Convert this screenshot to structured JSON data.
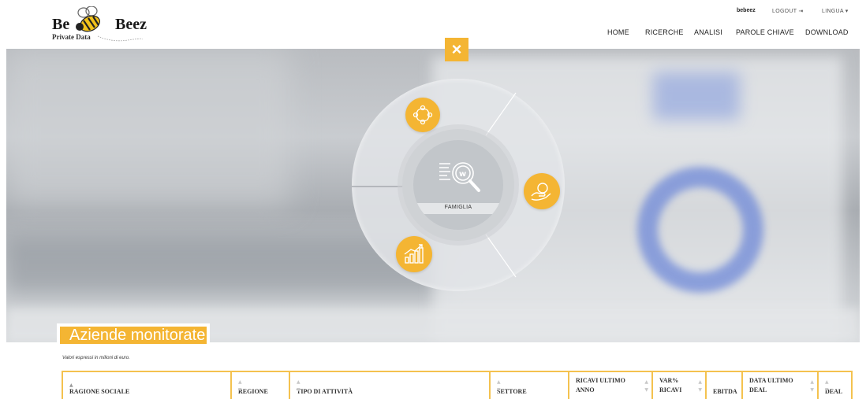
{
  "logo": {
    "word1": "Be",
    "word2": "Beez",
    "subtitle": "Private Data"
  },
  "user_bar": {
    "username": "bebeez",
    "logout": "LOGOUT",
    "logout_icon": "logout-icon",
    "language": "LINGUA",
    "language_icon": "chevron-down-icon"
  },
  "nav": {
    "items": [
      "HOME",
      "RICERCHE",
      "ANALISI",
      "PAROLE CHIAVE",
      "DOWNLOAD"
    ]
  },
  "hero": {
    "close_symbol": "×",
    "center_label": "FAMIGLIA",
    "center_icon": "search-document-icon",
    "bubbles": [
      "people-network-icon",
      "hand-money-icon",
      "growth-chart-icon"
    ],
    "accent_color": "#f4b533"
  },
  "section": {
    "title": "Aziende monitorate",
    "note": "Valori espressi in milioni di euro."
  },
  "table": {
    "columns": [
      {
        "line1": "RAGIONE SOCIALE",
        "line2": ""
      },
      {
        "line1": "REGIONE",
        "line2": ""
      },
      {
        "line1": "TIPO DI ATTIVITÀ",
        "line2": ""
      },
      {
        "line1": "SETTORE",
        "line2": ""
      },
      {
        "line1": "RICAVI ULTIMO",
        "line2": "ANNO"
      },
      {
        "line1": "VAR%",
        "line2": "RICAVI"
      },
      {
        "line1": "EBITDA",
        "line2": ""
      },
      {
        "line1": "DATA ULTIMO",
        "line2": "DEAL"
      },
      {
        "line1": "DEAL",
        "line2": ""
      }
    ]
  }
}
